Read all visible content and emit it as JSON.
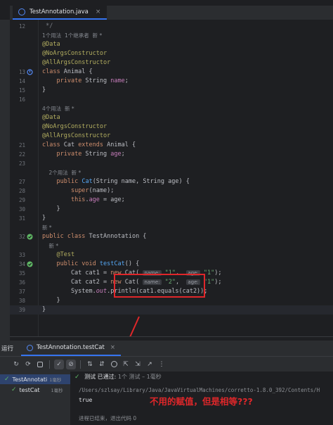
{
  "editor_tab": {
    "label": "TestAnnotation.java",
    "close": "×"
  },
  "code_lines": [
    {
      "num": "12",
      "html": "<span class=\"cm\"> */</span>"
    },
    {
      "num": "",
      "hint": "1个用法  1个继承者  新 *"
    },
    {
      "num": "",
      "html": "<span class=\"an\">@Data</span>"
    },
    {
      "num": "",
      "html": "<span class=\"an\">@NoArgsConstructor</span>"
    },
    {
      "num": "",
      "html": "<span class=\"an\">@AllArgsConstructor</span>"
    },
    {
      "num": "13",
      "icon": "impl",
      "html": "<span class=\"kw\">class</span> Animal {"
    },
    {
      "num": "14",
      "html": "    <span class=\"kw\">private</span> String <span class=\"fld\">name</span>;"
    },
    {
      "num": "15",
      "html": "}"
    },
    {
      "num": "16",
      "html": ""
    },
    {
      "num": "",
      "hint": "4个用法  新 *"
    },
    {
      "num": "",
      "html": "<span class=\"an\">@Data</span>"
    },
    {
      "num": "",
      "html": "<span class=\"an\">@NoArgsConstructor</span>"
    },
    {
      "num": "",
      "html": "<span class=\"an\">@AllArgsConstructor</span>"
    },
    {
      "num": "21",
      "html": "<span class=\"kw\">class</span> Cat <span class=\"kw\">extends</span> Animal {"
    },
    {
      "num": "22",
      "html": "    <span class=\"kw\">private</span> String <span class=\"fld\">age</span>;"
    },
    {
      "num": "23",
      "html": ""
    },
    {
      "num": "",
      "hint": "    2个用法  新 *"
    },
    {
      "num": "27",
      "html": "    <span class=\"kw\">public</span> <span class=\"fn\">Cat</span>(String name, String age) {"
    },
    {
      "num": "28",
      "html": "        <span class=\"kw\">super</span>(name);"
    },
    {
      "num": "29",
      "html": "        <span class=\"kw\">this</span>.<span class=\"fld\">age</span> = age;"
    },
    {
      "num": "30",
      "html": "    }"
    },
    {
      "num": "31",
      "html": "}"
    },
    {
      "num": "",
      "hint": "新 *"
    },
    {
      "num": "32",
      "icon": "run",
      "html": "<span class=\"kw\">public class</span> TestAnnotation {"
    },
    {
      "num": "",
      "hint": "    新 *"
    },
    {
      "num": "33",
      "html": "    <span class=\"an\">@Test</span>"
    },
    {
      "num": "34",
      "icon": "run",
      "html": "    <span class=\"kw\">public void</span> <span class=\"fn\">testCat</span>() {"
    },
    {
      "num": "35",
      "html": "        Cat cat1 = <span class=\"kw\">new</span> Cat( <span class=\"ph\">name:</span> <span class=\"str\">\"1\"</span>,  <span class=\"ph\">age:</span> <span class=\"str\">\"1\"</span>);"
    },
    {
      "num": "36",
      "html": "        Cat cat2 = <span class=\"kw\">new</span> Cat( <span class=\"ph\">name:</span> <span class=\"str\">\"2\"</span>,  <span class=\"ph\">age:</span> <span class=\"str\">\"1\"</span>);"
    },
    {
      "num": "37",
      "html": "        System.<span class=\"fld it\">out</span>.println(cat1.equals(cat2));"
    },
    {
      "num": "38",
      "html": "    }"
    },
    {
      "num": "39",
      "html": "}",
      "current": true
    }
  ],
  "run_panel": {
    "label": "运行",
    "tab": "TestAnnotation.testCat",
    "close": "×"
  },
  "test_tree": [
    {
      "label": "TestAnnotati",
      "duration": "1毫秒",
      "selected": true
    },
    {
      "label": "testCat",
      "duration": "1毫秒",
      "selected": false
    }
  ],
  "console": {
    "status_passed": "测试 已通过:",
    "status_detail": "1个 测试 – 1毫秒",
    "command": "/Users/szlsay/Library/Java/JavaVirtualMachines/corretto-1.8.0_392/Contents/H",
    "output": "true",
    "exit_text": "进程已结束，退出代码 0"
  },
  "annotation": "不用的赋值，但是相等???",
  "colors": {
    "annotation_red": "#e0272a",
    "accent_blue": "#3574f0",
    "pass_green": "#5fb865"
  }
}
